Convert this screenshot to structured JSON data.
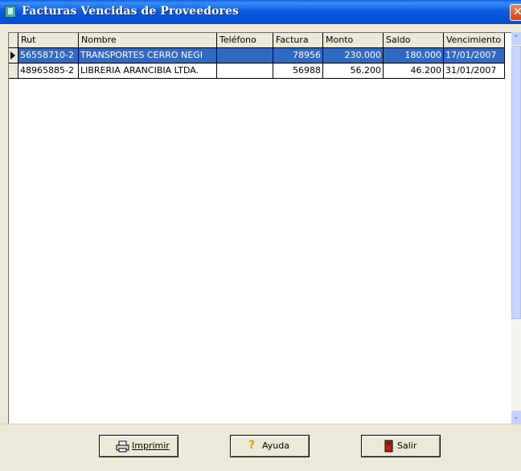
{
  "window": {
    "title": "Facturas Vencidas de Proveedores",
    "close_glyph": "✕"
  },
  "grid": {
    "columns": [
      "Rut",
      "Nombre",
      "Teléfono",
      "Factura",
      "Monto",
      "Saldo",
      "Vencimiento"
    ],
    "rows": [
      [
        "56558710-2",
        "TRANSPORTES CERRO NEGI",
        "",
        "78956",
        "230.000",
        "180.000",
        "17/01/2007"
      ],
      [
        "48965885-2",
        "LIBRERIA ARANCIBIA LTDA.",
        "",
        "56988",
        "56.200",
        "46.200",
        "31/01/2007"
      ]
    ],
    "selected_row": 0
  },
  "scrollbar": {
    "up_glyph": "⌃",
    "down_glyph": "⌄"
  },
  "buttons": {
    "imprimir": {
      "label": "Imprimir",
      "icon": "printer-icon"
    },
    "ayuda": {
      "label": "Ayuda",
      "icon": "question-icon",
      "icon_glyph": "?"
    },
    "salir": {
      "label": "Salir",
      "icon": "exit-door-icon"
    }
  },
  "colors": {
    "titlebar": "#0b5ce4",
    "selection": "#316ac5",
    "face": "#ece9d8",
    "question": "#e0a000",
    "exit": "#c81818"
  }
}
